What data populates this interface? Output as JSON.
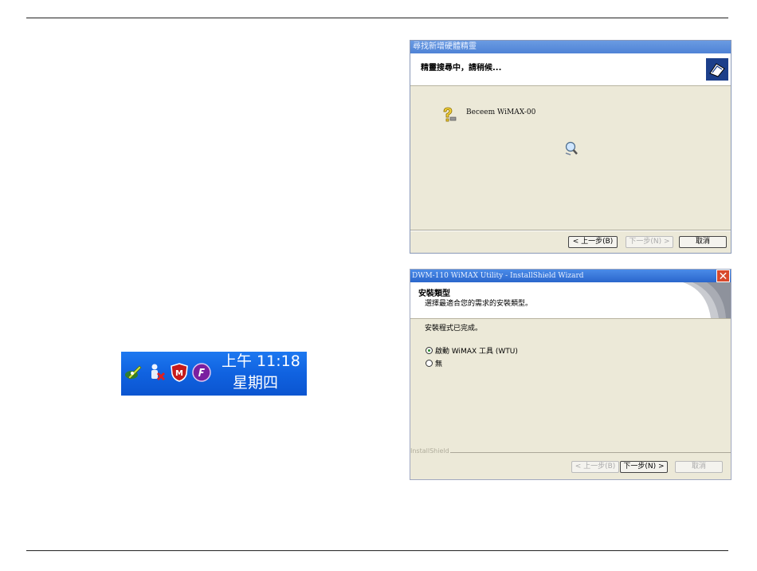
{
  "tray": {
    "time": "上午 11:18",
    "day": "星期四",
    "icons": [
      "network-pen-icon",
      "user-disconnect-icon",
      "mcafee-shield-icon",
      "purple-app-icon"
    ]
  },
  "wizard1": {
    "title": "尋找新增硬體精靈",
    "header": "精靈搜尋中，請稍候...",
    "device_name": "Beceem WiMAX-00",
    "buttons": {
      "back": "< 上一步(B)",
      "next": "下一步(N) >",
      "cancel": "取消"
    }
  },
  "wizard2": {
    "title": "DWM-110 WiMAX Utility - InstallShield Wizard",
    "header_title": "安裝類型",
    "header_subtitle": "選擇最適合您的需求的安裝類型。",
    "status": "安裝程式已完成。",
    "options": [
      {
        "label": "啟動 WiMAX 工具 (WTU)",
        "selected": true
      },
      {
        "label": "無",
        "selected": false
      }
    ],
    "installshield_label": "InstallShield",
    "buttons": {
      "back": "< 上一步(B)",
      "next": "下一步(N) >",
      "cancel": "取消"
    }
  },
  "colors": {
    "taskbar_blue": "#1062e0",
    "dialog_bg": "#ece9d8",
    "title_blue": "#4f83d6",
    "close_red": "#d8492c"
  }
}
